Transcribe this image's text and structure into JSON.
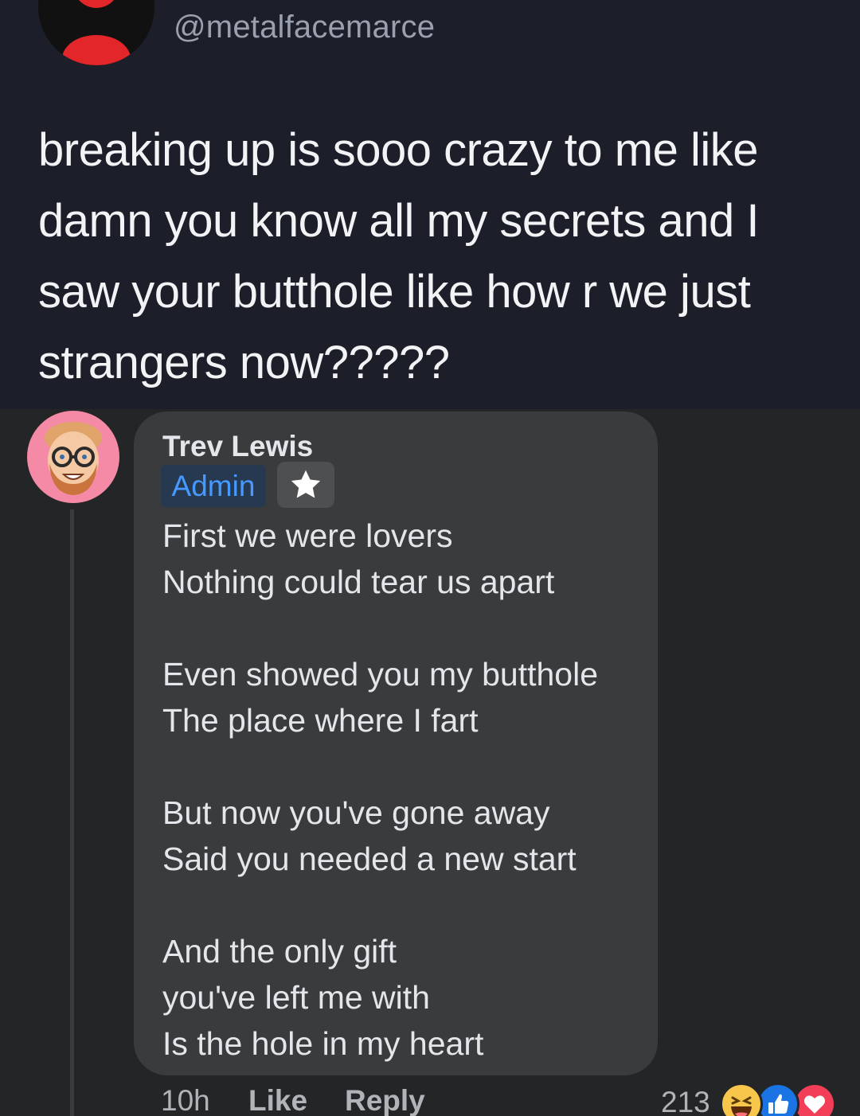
{
  "tweet": {
    "handle": "@metalfacemarce",
    "lines": [
      "breaking up is sooo crazy to me like",
      "damn you know all my secrets and I",
      "saw your butthole like how r we just",
      "strangers now?????"
    ]
  },
  "comment": {
    "author": "Trev Lewis",
    "badge": "Admin",
    "badge_icon": "star-icon",
    "stanzas": [
      [
        "First we were lovers",
        "Nothing could tear us apart"
      ],
      [
        "Even showed you my butthole",
        "The place where I fart"
      ],
      [
        "But now you've gone away",
        "Said you needed a new start"
      ],
      [
        "And the only gift",
        "you've left me with",
        "Is the hole in my heart"
      ]
    ],
    "time": "10h",
    "like_label": "Like",
    "reply_label": "Reply",
    "reaction_count": "213",
    "reactions": [
      "haha-icon",
      "like-icon",
      "love-icon"
    ]
  },
  "colors": {
    "tweet_bg": "#1c1e2a",
    "page_bg": "#242526",
    "bubble_bg": "#3a3b3c",
    "admin_text": "#4599ff",
    "avatar_pink": "#f48aa6"
  }
}
